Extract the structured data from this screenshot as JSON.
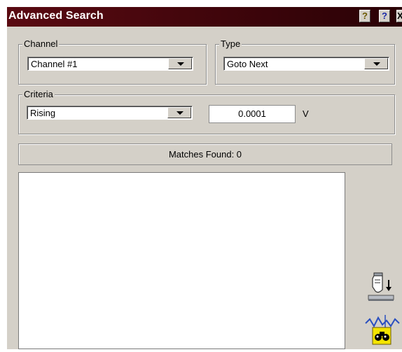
{
  "window": {
    "title": "Advanced Search"
  },
  "titlebar_buttons": {
    "hint": "?",
    "help": "?",
    "close": "X"
  },
  "channel": {
    "label": "Channel",
    "value": "Channel #1"
  },
  "type": {
    "label": "Type",
    "value": "Goto Next"
  },
  "criteria": {
    "label": "Criteria",
    "edge_value": "Rising",
    "threshold": "0.0001",
    "unit": "V"
  },
  "status": {
    "matches": "Matches Found: 0"
  },
  "icons": {
    "export": "hand-pointer-export-icon",
    "search": "binoculars-waveform-search-icon"
  },
  "colors": {
    "titlebar": "#4a0710",
    "panel": "#d4d0c8",
    "icon_yellow": "#f4e400"
  }
}
